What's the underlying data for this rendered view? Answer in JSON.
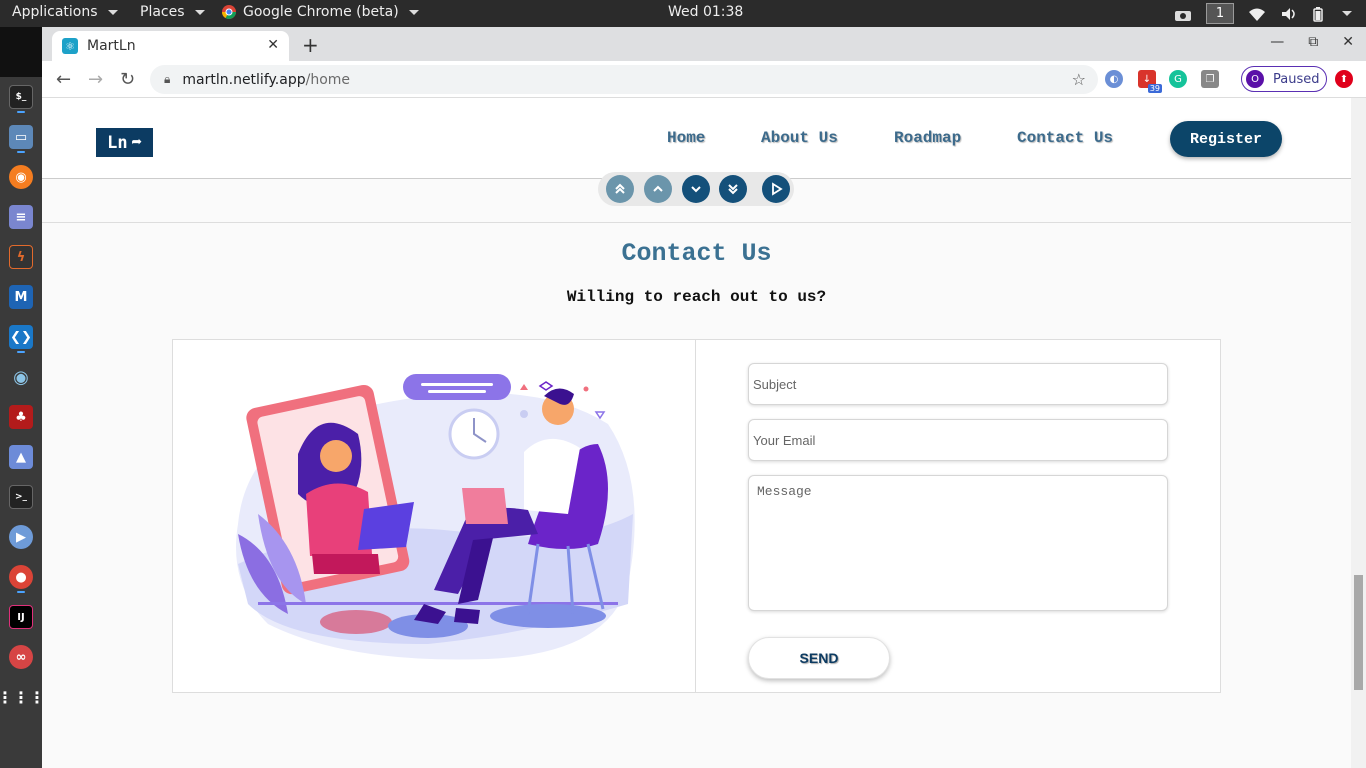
{
  "system_bar": {
    "applications": "Applications",
    "places": "Places",
    "active_app": "Google Chrome (beta)",
    "clock": "Wed 01:38",
    "workspace": "1"
  },
  "browser": {
    "tab_title": "MartLn",
    "url_host": "martln.netlify.app",
    "url_path": "/home",
    "extension_badge": "39",
    "profile_initial": "O",
    "profile_status": "Paused"
  },
  "site": {
    "logo_text": "Ln",
    "nav": {
      "home": "Home",
      "about": "About Us",
      "roadmap": "Roadmap",
      "contact": "Contact Us"
    },
    "register_label": "Register"
  },
  "contact": {
    "title": "Contact Us",
    "subtitle": "Willing to reach out to us?",
    "subject_placeholder": "Subject",
    "email_placeholder": "Your Email",
    "message_placeholder": "Message",
    "send_label": "SEND"
  },
  "colors": {
    "brand": "#0c3b62",
    "nav_text": "#3d6b8c",
    "title": "#3b7192"
  }
}
